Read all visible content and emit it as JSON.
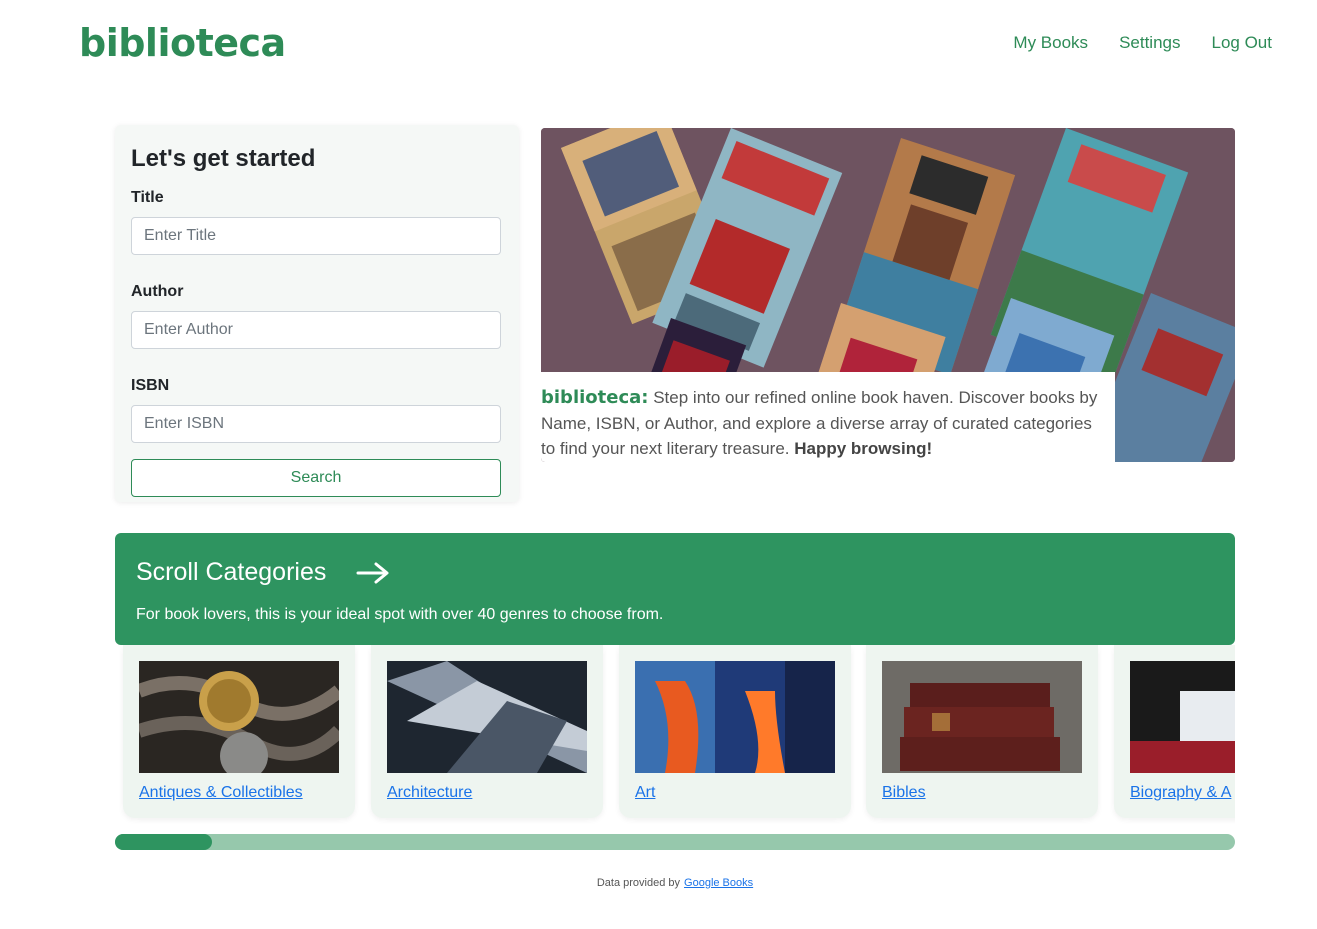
{
  "brand": {
    "name": "biblioteca",
    "color": "#2e8b57"
  },
  "nav": {
    "items": [
      "My Books",
      "Settings",
      "Log Out"
    ]
  },
  "search_form": {
    "heading": "Let's get started",
    "fields": [
      {
        "label": "Title",
        "placeholder": "Enter Title",
        "value": ""
      },
      {
        "label": "Author",
        "placeholder": "Enter Author",
        "value": ""
      },
      {
        "label": "ISBN",
        "placeholder": "Enter ISBN",
        "value": ""
      }
    ],
    "button_label": "Search"
  },
  "hero": {
    "caption_brand": "biblioteca:",
    "caption_text": "Step into our refined online book haven. Discover books by Name, ISBN, or Author, and explore a diverse array of curated categories to find your next literary treasure.",
    "caption_bold": "Happy browsing!"
  },
  "categories": {
    "title": "Scroll Categories",
    "subtitle": "For book lovers, this is your ideal spot with over 40 genres to choose from.",
    "arrow_icon": "arrow-right-icon",
    "items": [
      {
        "label": "Antiques & Collectibles",
        "icon": "coins-image"
      },
      {
        "label": "Architecture",
        "icon": "building-image"
      },
      {
        "label": "Art",
        "icon": "painting-image"
      },
      {
        "label": "Bibles",
        "icon": "bible-stack-image"
      },
      {
        "label": "Biography & A",
        "icon": "book-image"
      }
    ],
    "scroll_progress": 0.087
  },
  "footer": {
    "prefix": "Data provided by",
    "link": "Google Books"
  },
  "colors": {
    "accent": "#2e8b57",
    "banner": "#2e9460",
    "link": "#1a73e8",
    "track": "#96c8ac"
  }
}
